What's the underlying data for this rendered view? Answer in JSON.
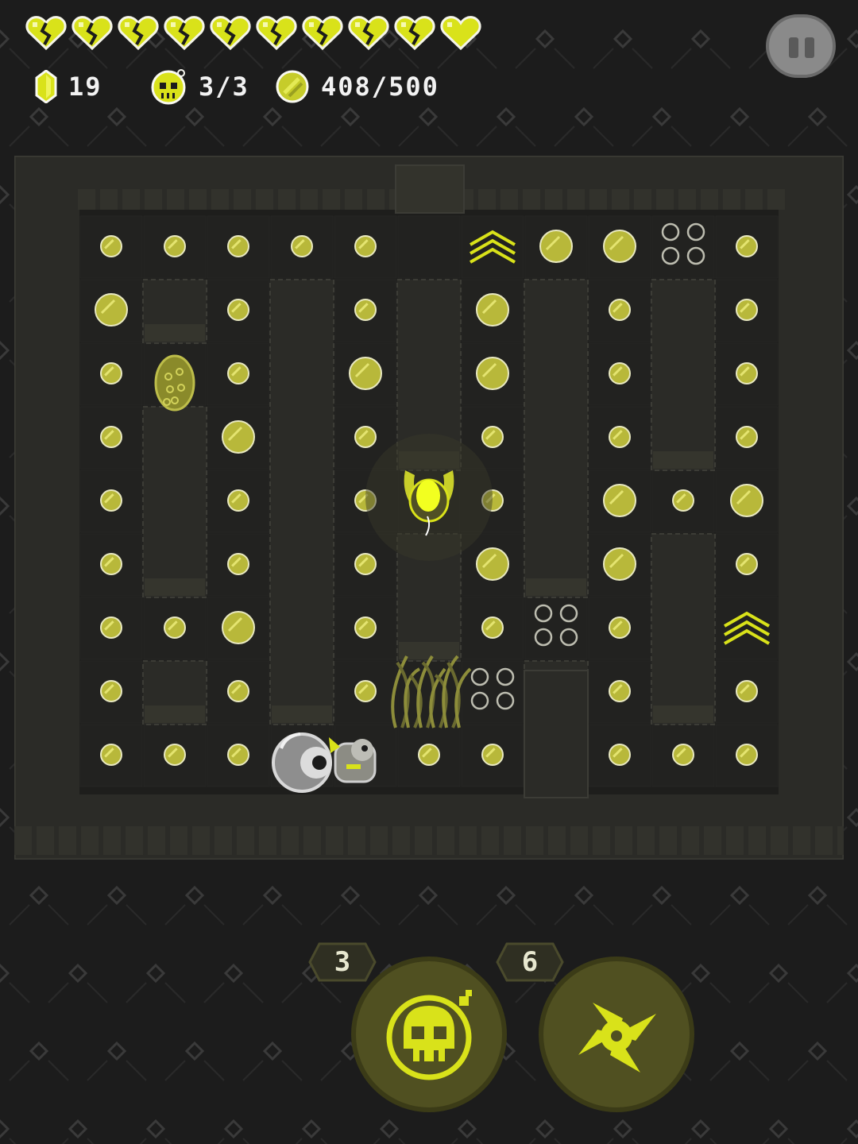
{
  "hud": {
    "hearts": [
      "broken",
      "broken",
      "broken",
      "broken",
      "broken",
      "broken",
      "broken",
      "broken",
      "broken",
      "full"
    ],
    "gems": "19",
    "skulls": "3/3",
    "coins": "408/500"
  },
  "abilities": [
    {
      "name": "skull-ability",
      "count": "3"
    },
    {
      "name": "shuriken-ability",
      "count": "6"
    }
  ],
  "colors": {
    "accent": "#d9e21a",
    "pellet": "#b8b83a",
    "background": "#1c1c1c",
    "wall": "#2b2b27",
    "floor": "#1e1e1c"
  }
}
